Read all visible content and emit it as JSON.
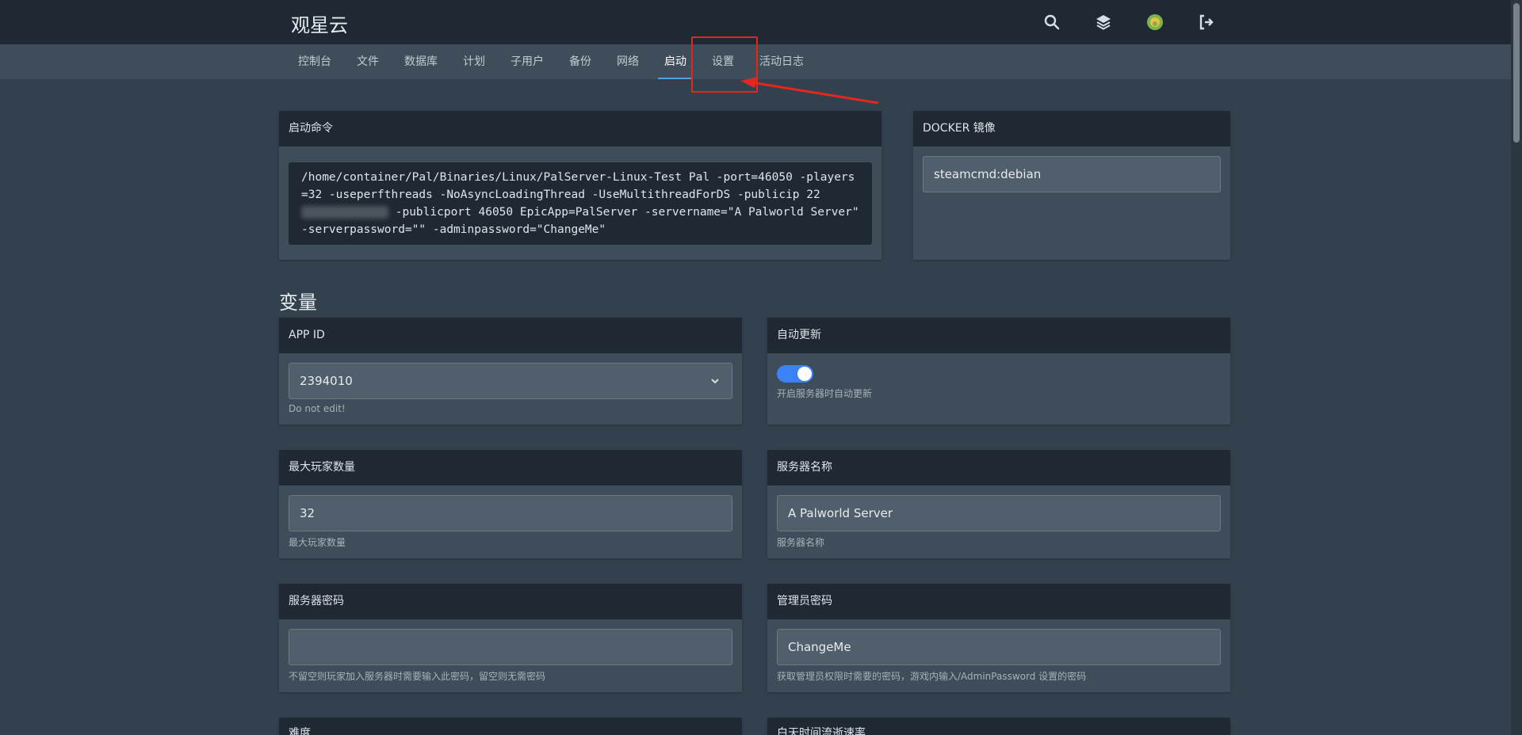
{
  "app": {
    "brand": "观星云"
  },
  "top_icons": [
    "search-icon",
    "layers-icon",
    "avatar",
    "logout-icon"
  ],
  "tabs": [
    {
      "label": "控制台"
    },
    {
      "label": "文件"
    },
    {
      "label": "数据库"
    },
    {
      "label": "计划"
    },
    {
      "label": "子用户"
    },
    {
      "label": "备份"
    },
    {
      "label": "网络"
    },
    {
      "label": "启动",
      "active": true
    },
    {
      "label": "设置"
    },
    {
      "label": "活动日志"
    }
  ],
  "startup": {
    "title": "启动命令",
    "command_part1": "/home/container/Pal/Binaries/Linux/PalServer-Linux-Test Pal -port=46050 -players=32 -useperfthreads -NoAsyncLoadingThread -UseMultithreadForDS -publicip 22",
    "command_part2": " -publicport 46050 EpicApp=PalServer -servername=\"A Palworld Server\" -serverpassword=\"\" -adminpassword=\"ChangeMe\""
  },
  "docker": {
    "title": "DOCKER 镜像",
    "value": "steamcmd:debian"
  },
  "variables_title": "变量",
  "variables": {
    "app_id": {
      "title": "APP ID",
      "value": "2394010",
      "help": "Do not edit!"
    },
    "auto_update": {
      "title": "自动更新",
      "enabled": true,
      "help": "开启服务器时自动更新"
    },
    "max_players": {
      "title": "最大玩家数量",
      "value": "32",
      "help": "最大玩家数量"
    },
    "server_name": {
      "title": "服务器名称",
      "value": "A Palworld Server",
      "help": "服务器名称"
    },
    "server_password": {
      "title": "服务器密码",
      "value": "",
      "help": "不留空则玩家加入服务器时需要输入此密码，留空则无需密码"
    },
    "admin_password": {
      "title": "管理员密码",
      "value": "ChangeMe",
      "help": "获取管理员权限时需要的密码，游戏内输入/AdminPassword 设置的密码"
    },
    "difficulty": {
      "title": "难度"
    },
    "day_speed": {
      "title": "白天时间流逝速率"
    }
  },
  "colors": {
    "accent": "#3b82f6",
    "annotation": "#e5261f",
    "header": "#1f2933"
  }
}
